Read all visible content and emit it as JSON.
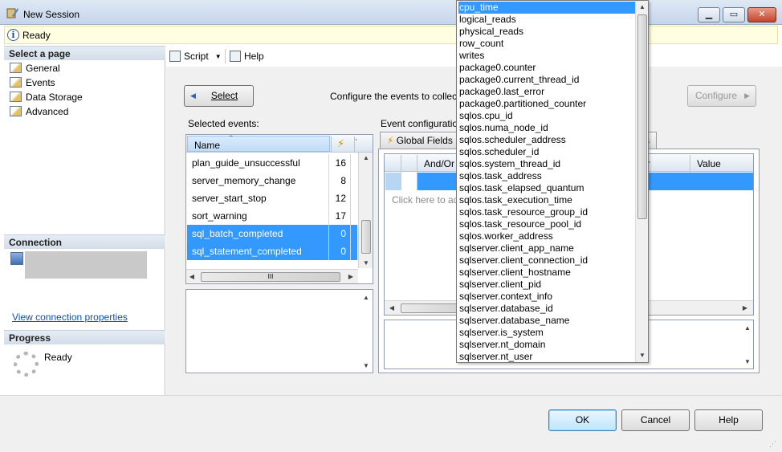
{
  "window": {
    "title": "New Session"
  },
  "banner": {
    "status": "Ready"
  },
  "left_pane": {
    "select_header": "Select a page",
    "pages": [
      "General",
      "Events",
      "Data Storage",
      "Advanced"
    ],
    "connection_header": "Connection",
    "view_connection_link": "View connection properties",
    "progress_header": "Progress",
    "progress_status": "Ready"
  },
  "toolbar": {
    "script_label": "Script",
    "help_label": "Help"
  },
  "events_page": {
    "select_button": "Select",
    "configure_text": "Configure the events to collec",
    "configure_button": "Configure",
    "selected_events_label": "Selected events:",
    "event_config_label": "Event configuratio",
    "name_column": "Name",
    "rows": [
      {
        "name": "plan_guide_unsuccessful",
        "count": "16",
        "selected": false
      },
      {
        "name": "server_memory_change",
        "count": "8",
        "selected": false
      },
      {
        "name": "server_start_stop",
        "count": "12",
        "selected": false
      },
      {
        "name": "sort_warning",
        "count": "17",
        "selected": false
      },
      {
        "name": "sql_batch_completed",
        "count": "0",
        "selected": true
      },
      {
        "name": "sql_statement_completed",
        "count": "0",
        "selected": true
      }
    ],
    "hscroll_grip": "III",
    "tab_global_fields": "Global Fields",
    "tab_right_fragment": "s",
    "filter_columns": {
      "and_or": "And/Or",
      "operator": "or",
      "value": "Value"
    },
    "filter_placeholder": "Click here to ad"
  },
  "dropdown": {
    "items": [
      "cpu_time",
      "logical_reads",
      "physical_reads",
      "row_count",
      "writes",
      "package0.counter",
      "package0.current_thread_id",
      "package0.last_error",
      "package0.partitioned_counter",
      "sqlos.cpu_id",
      "sqlos.numa_node_id",
      "sqlos.scheduler_address",
      "sqlos.scheduler_id",
      "sqlos.system_thread_id",
      "sqlos.task_address",
      "sqlos.task_elapsed_quantum",
      "sqlos.task_execution_time",
      "sqlos.task_resource_group_id",
      "sqlos.task_resource_pool_id",
      "sqlos.worker_address",
      "sqlserver.client_app_name",
      "sqlserver.client_connection_id",
      "sqlserver.client_hostname",
      "sqlserver.client_pid",
      "sqlserver.context_info",
      "sqlserver.database_id",
      "sqlserver.database_name",
      "sqlserver.is_system",
      "sqlserver.nt_domain",
      "sqlserver.nt_user"
    ],
    "selected_index": 0
  },
  "footer": {
    "ok": "OK",
    "cancel": "Cancel",
    "help": "Help"
  },
  "icons": [
    "app-icon",
    "info-icon",
    "page-icon",
    "connection-icon",
    "script-icon",
    "help-icon",
    "back-arrow-icon",
    "forward-arrow-icon",
    "lightning-icon",
    "sort-arrow-icon",
    "spinner-icon"
  ]
}
